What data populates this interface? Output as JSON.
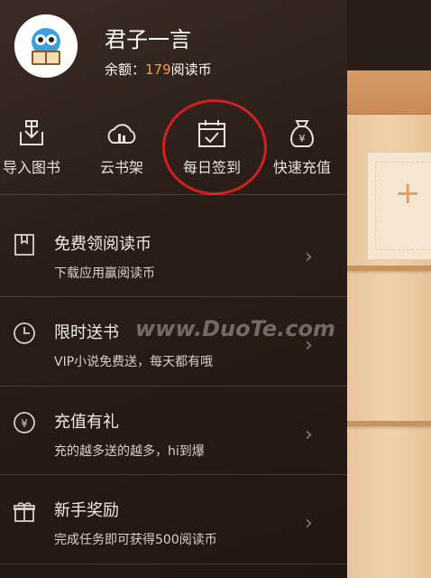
{
  "profile": {
    "name": "君子一言",
    "balance_label": "余额：",
    "balance_value": "179",
    "balance_unit": "阅读币"
  },
  "quick_actions": [
    {
      "label": "导入图书",
      "icon": "import-icon"
    },
    {
      "label": "云书架",
      "icon": "cloud-shelf-icon"
    },
    {
      "label": "每日签到",
      "icon": "calendar-check-icon"
    },
    {
      "label": "快速充值",
      "icon": "money-bag-icon"
    }
  ],
  "menu": [
    {
      "title": "免费领阅读币",
      "subtitle": "下载应用赢阅读币",
      "icon": "bookmark-icon"
    },
    {
      "title": "限时送书",
      "subtitle": "VIP小说免费送，每天都有哦",
      "icon": "clock-icon"
    },
    {
      "title": "充值有礼",
      "subtitle": "充的越多送的越多，hi到爆",
      "icon": "yen-coin-icon"
    },
    {
      "title": "新手奖励",
      "subtitle": "完成任务即可获得500阅读币",
      "icon": "gift-icon"
    }
  ],
  "watermark": "www.DuoTe.com",
  "colors": {
    "accent": "#f0a04b",
    "highlight_circle": "#d02020"
  }
}
